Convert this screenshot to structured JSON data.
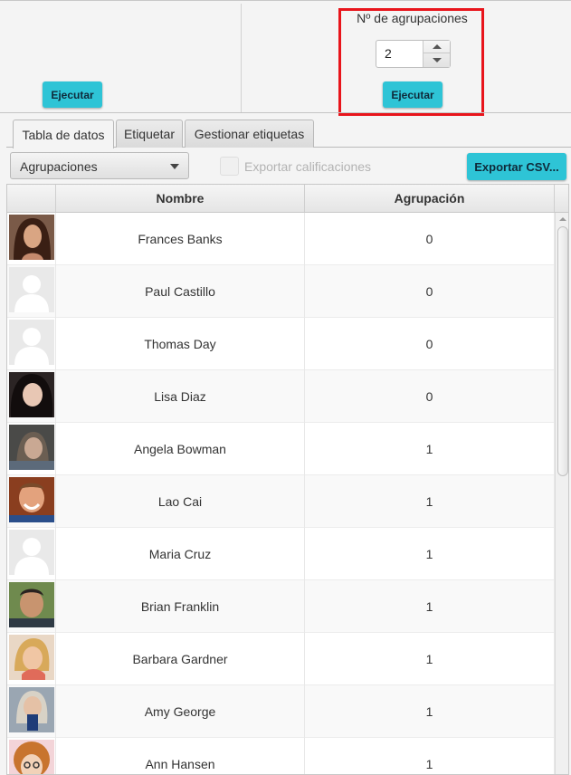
{
  "top": {
    "left_execute": "Ejecutar",
    "group_label": "Nº de agrupaciones",
    "group_count": "2",
    "right_execute": "Ejecutar"
  },
  "tabs": [
    {
      "label": "Tabla de datos",
      "active": true
    },
    {
      "label": "Etiquetar",
      "active": false
    },
    {
      "label": "Gestionar etiquetas",
      "active": false
    }
  ],
  "toolbar": {
    "combo_value": "Agrupaciones",
    "checkbox_label": "Exportar calificaciones",
    "export_label": "Exportar CSV..."
  },
  "table": {
    "columns": [
      "",
      "Nombre",
      "Agrupación"
    ],
    "rows": [
      {
        "name": "Frances Banks",
        "group": "0",
        "avatar": "photo-woman-dark-hair"
      },
      {
        "name": "Paul Castillo",
        "group": "0",
        "avatar": "default-user"
      },
      {
        "name": "Thomas Day",
        "group": "0",
        "avatar": "default-user"
      },
      {
        "name": "Lisa Diaz",
        "group": "0",
        "avatar": "photo-woman-black-hair"
      },
      {
        "name": "Angela Bowman",
        "group": "1",
        "avatar": "photo-woman-grey"
      },
      {
        "name": "Lao Cai",
        "group": "1",
        "avatar": "photo-man-smiling"
      },
      {
        "name": "Maria Cruz",
        "group": "1",
        "avatar": "default-user"
      },
      {
        "name": "Brian Franklin",
        "group": "1",
        "avatar": "photo-man-outdoor"
      },
      {
        "name": "Barbara Gardner",
        "group": "1",
        "avatar": "photo-woman-blonde"
      },
      {
        "name": "Amy George",
        "group": "1",
        "avatar": "photo-woman-drink"
      },
      {
        "name": "Ann Hansen",
        "group": "1",
        "avatar": "cartoon-curly-hair"
      }
    ]
  },
  "colors": {
    "accent_button": "#2ec4d6",
    "highlight_border": "#e8141b"
  }
}
